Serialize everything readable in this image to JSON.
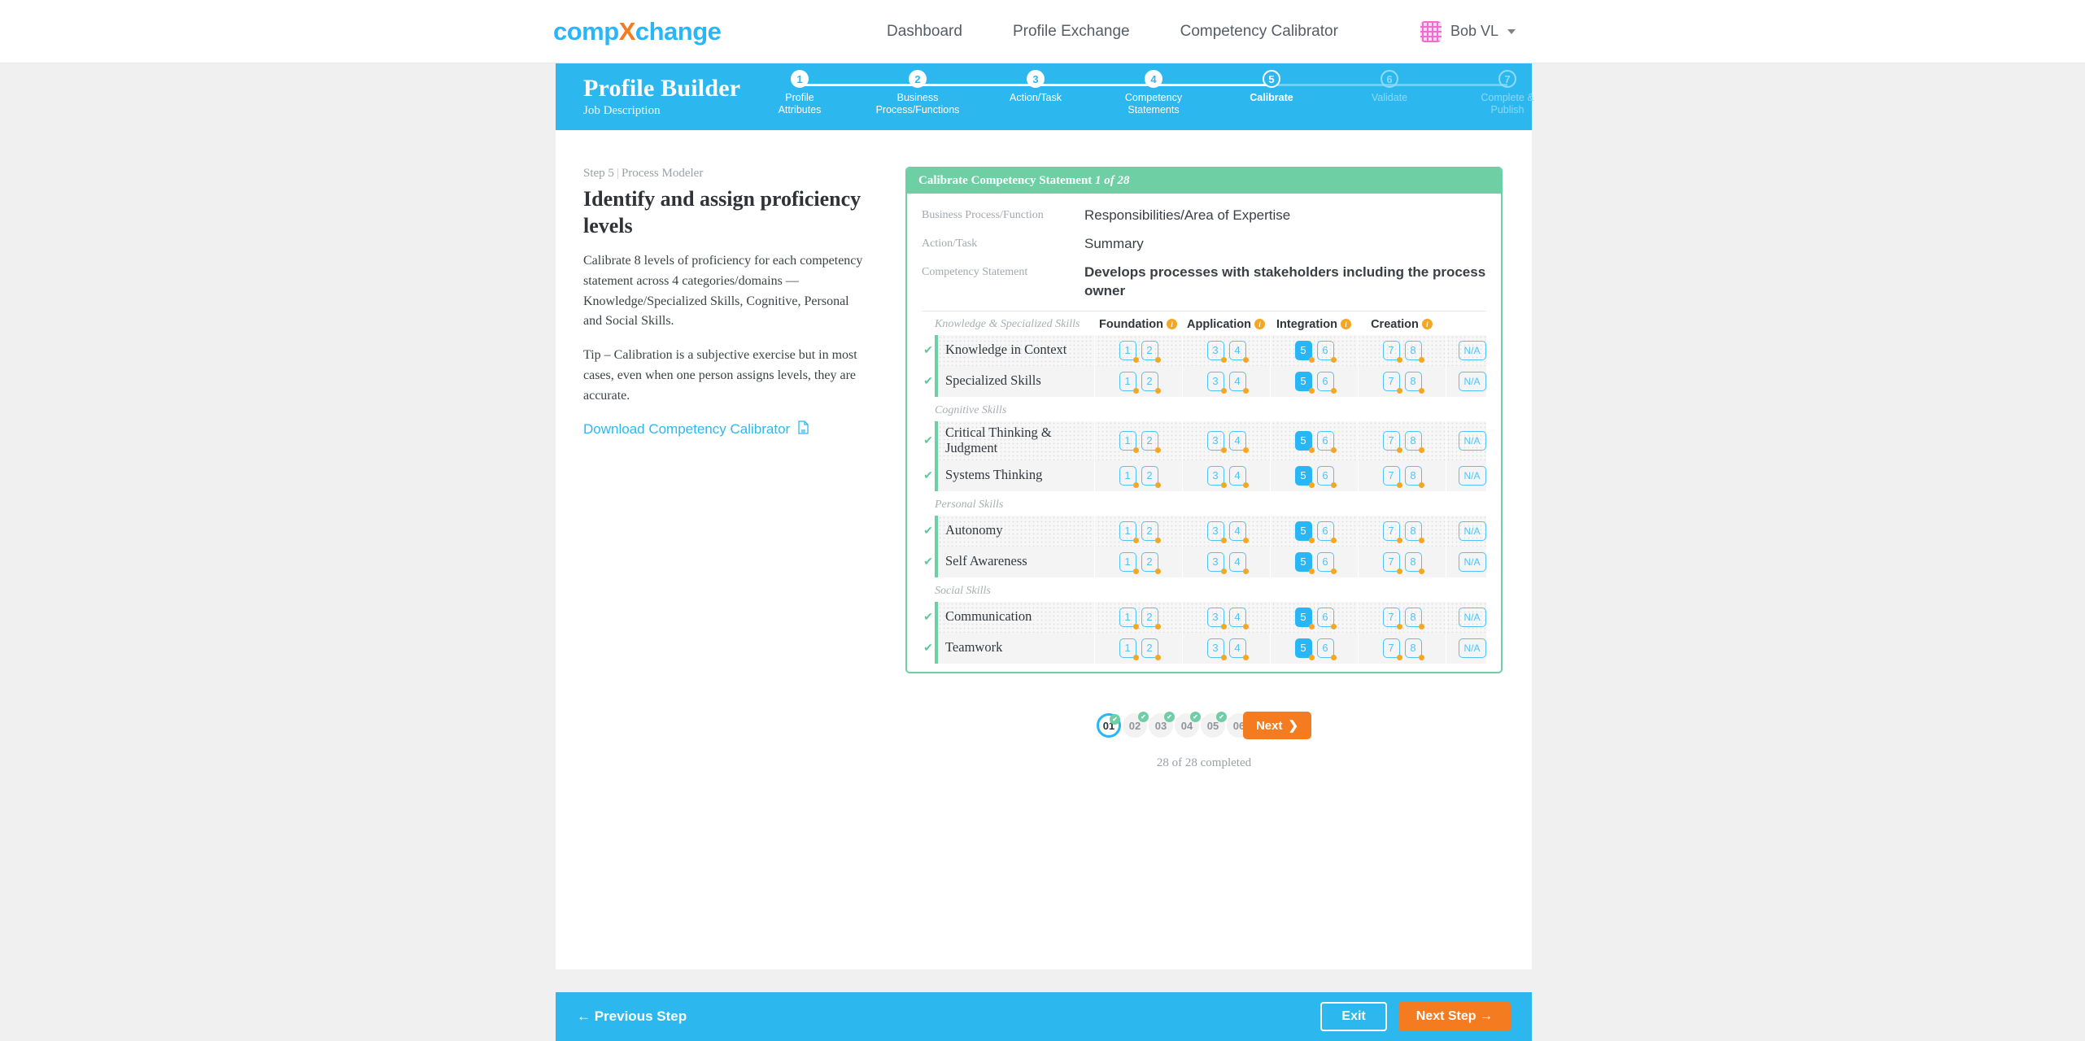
{
  "nav": {
    "logo_left": "comp",
    "logo_x": "X",
    "logo_right": "change",
    "links": [
      {
        "label": "Dashboard"
      },
      {
        "label": "Profile Exchange"
      },
      {
        "label": "Competency Calibrator"
      }
    ],
    "user": {
      "name": "Bob VL"
    }
  },
  "builder": {
    "title": "Profile Builder",
    "subtitle": "Job Description",
    "steps": [
      {
        "num": "1",
        "label": "Profile\nAttributes",
        "state": "done"
      },
      {
        "num": "2",
        "label": "Business\nProcess/Functions",
        "state": "done"
      },
      {
        "num": "3",
        "label": "Action/Task",
        "state": "done"
      },
      {
        "num": "4",
        "label": "Competency\nStatements",
        "state": "done"
      },
      {
        "num": "5",
        "label": "Calibrate",
        "state": "current"
      },
      {
        "num": "6",
        "label": "Validate",
        "state": "dim"
      },
      {
        "num": "7",
        "label": "Complete &\nPublish",
        "state": "dim"
      }
    ]
  },
  "left_panel": {
    "step_label": "Step 5",
    "role_label": "Process Modeler",
    "title": "Identify and assign proficiency levels",
    "paragraph1": "Calibrate 8 levels of proficiency for each competency statement across 4 categories/domains — Knowledge/Specialized Skills, Cognitive, Personal and Social Skills.",
    "paragraph2": "Tip – Calibration is a subjective exercise but in most cases, even when one person assigns levels, they are accurate.",
    "download_label": "Download Competency Calibrator"
  },
  "card": {
    "header_prefix": "Calibrate Competency Statement",
    "header_counter": "1 of 28",
    "meta": [
      {
        "label": "Business Process/Function",
        "value": "Responsibilities/Area of Expertise",
        "bold": false
      },
      {
        "label": "Action/Task",
        "value": "Summary",
        "bold": false
      },
      {
        "label": "Competency Statement",
        "value": "Develops processes with stakeholders including the process owner",
        "bold": true
      }
    ],
    "matrix": {
      "skills_col_header": "Knowledge & Specialized Skills",
      "domains": [
        {
          "label": "Foundation",
          "levels": [
            "1",
            "2"
          ]
        },
        {
          "label": "Application",
          "levels": [
            "3",
            "4"
          ]
        },
        {
          "label": "Integration",
          "levels": [
            "5",
            "6"
          ]
        },
        {
          "label": "Creation",
          "levels": [
            "7",
            "8"
          ]
        }
      ],
      "na_label": "N/A",
      "selected_level": "5",
      "groups": [
        {
          "label": "",
          "rows": [
            {
              "name": "Knowledge in Context",
              "checked": true
            },
            {
              "name": "Specialized Skills",
              "checked": true
            }
          ]
        },
        {
          "label": "Cognitive Skills",
          "rows": [
            {
              "name": "Critical Thinking & Judgment",
              "checked": true
            },
            {
              "name": "Systems Thinking",
              "checked": true
            }
          ]
        },
        {
          "label": "Personal Skills",
          "rows": [
            {
              "name": "Autonomy",
              "checked": true
            },
            {
              "name": "Self Awareness",
              "checked": true
            }
          ]
        },
        {
          "label": "Social Skills",
          "rows": [
            {
              "name": "Communication",
              "checked": true
            },
            {
              "name": "Teamwork",
              "checked": true
            }
          ]
        }
      ]
    }
  },
  "pager": {
    "pages": [
      {
        "label": "01",
        "active": true,
        "done": true
      },
      {
        "label": "02",
        "active": false,
        "done": true
      },
      {
        "label": "03",
        "active": false,
        "done": true
      },
      {
        "label": "04",
        "active": false,
        "done": true
      },
      {
        "label": "05",
        "active": false,
        "done": true
      },
      {
        "label": "06",
        "active": false,
        "done": false
      }
    ],
    "next_label": "Next",
    "completed_text": "28 of 28 completed"
  },
  "footer": {
    "previous_label": "← Previous Step",
    "exit_label": "Exit",
    "next_step_label": "Next Step →"
  },
  "colors": {
    "brand_blue": "#2cb8ef",
    "accent_orange": "#f47b20",
    "green": "#6ecfa5",
    "level_blue": "#29b6f6",
    "info_orange": "#f5a623"
  }
}
